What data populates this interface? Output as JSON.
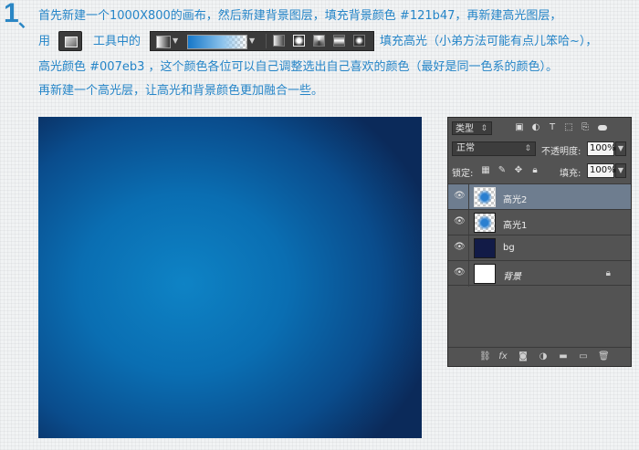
{
  "step": {
    "number": "1",
    "comma": "、"
  },
  "instructions": {
    "line1": "首先新建一个1000X800的画布，然后新建背景图层，填充背景颜色 #121b47，再新建高光图层，",
    "line2_prefix": "用",
    "line2_mid": "工具中的",
    "line2_suffix": "填充高光（小弟方法可能有点儿笨哈~），",
    "line3": "高光颜色 #007eb3 ，这个颜色各位可以自己调整选出自己喜欢的颜色（最好是同一色系的颜色）。",
    "line4": "再新建一个高光层，让高光和背景颜色更加融合一些。"
  },
  "colors": {
    "text_accent": "#2585c8",
    "bg_fill": "#121b47",
    "highlight": "#007eb3"
  },
  "tool": {
    "icon": "gradient-tool-icon"
  },
  "gradient_options": {
    "modes": [
      "linear",
      "radial",
      "angle",
      "reflected",
      "diamond"
    ],
    "active_mode": "radial"
  },
  "layers_panel": {
    "kind_label": "类型",
    "blend_mode": "正常",
    "opacity_label": "不透明度:",
    "opacity_value": "100%",
    "lock_label": "锁定:",
    "fill_label": "填充:",
    "fill_value": "100%",
    "layers": [
      {
        "name": "高光2",
        "selected": true
      },
      {
        "name": "高光1",
        "selected": false
      },
      {
        "name": "bg",
        "selected": false
      },
      {
        "name": "背景",
        "selected": false,
        "locked": true
      }
    ]
  }
}
